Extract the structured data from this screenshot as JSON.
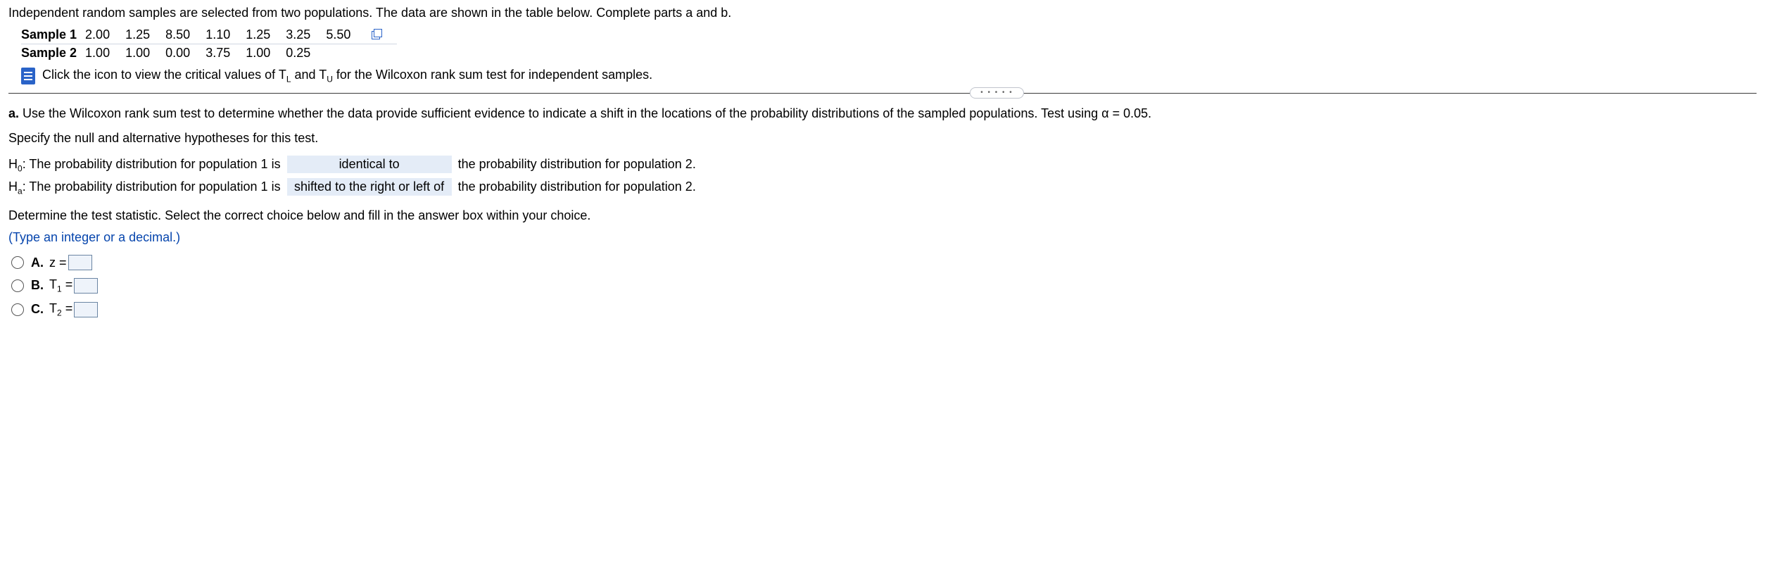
{
  "intro_text": "Independent random samples are selected from two populations. The data are shown in the table below. Complete parts a and b.",
  "table": {
    "row1_label": "Sample 1",
    "row1_values": [
      "2.00",
      "1.25",
      "8.50",
      "1.10",
      "1.25",
      "3.25",
      "5.50"
    ],
    "row2_label": "Sample 2",
    "row2_values": [
      "1.00",
      "1.00",
      "0.00",
      "3.75",
      "1.00",
      "0.25"
    ]
  },
  "critical_values_text_1": "Click the icon to view the critical values of T",
  "critical_values_sub_L": "L",
  "critical_values_text_2": " and T",
  "critical_values_sub_U": "U",
  "critical_values_text_3": " for the Wilcoxon rank sum test for independent samples.",
  "divider_dots": "•  •  •  •  •",
  "question_a_prefix": "a. ",
  "question_a_text": "Use the Wilcoxon rank sum test to determine whether the data provide sufficient evidence to indicate a shift in the locations of the probability distributions of the sampled populations. Test using α = 0.05.",
  "hypothesis_prompt": "Specify the null and alternative hypotheses for this test.",
  "h0_prefix": "H",
  "h0_sub": "0",
  "h0_lead": ": The probability distribution for population 1 is",
  "h0_fill": "identical to",
  "h0_tail": "the probability distribution for population 2.",
  "ha_prefix": "H",
  "ha_sub": "a",
  "ha_lead": ": The probability distribution for population 1 is",
  "ha_fill": "shifted to the right or left of",
  "ha_tail": "the probability distribution for population 2.",
  "test_stat_instruction": "Determine the test statistic. Select the correct choice below and fill in the answer box within your choice.",
  "type_hint": "(Type an integer or a decimal.)",
  "choice_a_label": "A.",
  "choice_a_text": "z =",
  "choice_b_label": "B.",
  "choice_b_text_1": "T",
  "choice_b_sub": "1",
  "choice_b_text_2": " =",
  "choice_c_label": "C.",
  "choice_c_text_1": "T",
  "choice_c_sub": "2",
  "choice_c_text_2": " ="
}
